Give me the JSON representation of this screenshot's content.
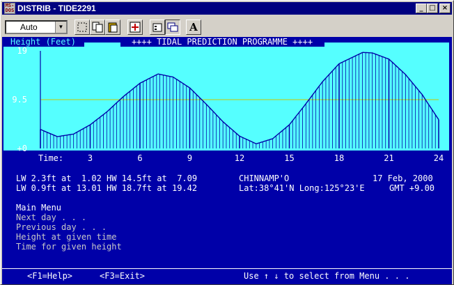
{
  "window": {
    "title": "DISTRIB - TIDE2291",
    "app_icon_text": "MS-DOS"
  },
  "title_buttons": {
    "minimize": "_",
    "maximize": "□",
    "close": "×"
  },
  "toolbar": {
    "font_select": "Auto",
    "font_button_label": "A"
  },
  "chart_data": {
    "type": "area",
    "title": "++++ TIDAL PREDICTION PROGRAMME ++++",
    "ylabel": "Height (Feet)",
    "xlabel": "Time:",
    "xlim": [
      0,
      24
    ],
    "ylim": [
      0,
      19
    ],
    "x_ticks": [
      3,
      6,
      9,
      12,
      15,
      18,
      21,
      24
    ],
    "y_ticks": [
      {
        "value": 19,
        "label": "19"
      },
      {
        "value": 9.5,
        "label": "9.5"
      },
      {
        "value": 0,
        "label": "+0"
      }
    ],
    "series": [
      {
        "x": [
          0,
          1.02,
          2,
          3,
          4,
          5,
          6,
          7.09,
          8,
          9,
          10,
          11,
          12,
          13.01,
          14,
          15,
          16,
          17,
          18,
          19.42,
          20,
          21,
          22,
          23,
          24
        ],
        "y": [
          3.7,
          2.3,
          2.8,
          4.6,
          7.1,
          10.1,
          12.7,
          14.5,
          13.9,
          11.8,
          8.6,
          5.2,
          2.4,
          0.9,
          1.9,
          4.6,
          8.7,
          13.0,
          16.5,
          18.7,
          18.6,
          17.4,
          14.4,
          10.5,
          5.6
        ]
      }
    ],
    "colors": {
      "background": "#55ffff",
      "curve": "#0000a8",
      "gridline": "#c8c800"
    },
    "grid": true
  },
  "tides": {
    "line1": "LW 2.3ft at  1.02 HW 14.5ft at  7.09",
    "line2": "LW 0.9ft at 13.01 HW 18.7ft at 19.42"
  },
  "station": {
    "name": "CHINNAMP'O",
    "date": "17 Feb, 2000",
    "coords": "Lat:38°41'N Long:125°23'E",
    "gmt": "GMT +9.00"
  },
  "menu": {
    "title": "Main Menu",
    "items": [
      "Next day . . .",
      "Previous day . . .",
      "Height at given time",
      "Time for given height"
    ]
  },
  "status": {
    "help": "<F1=Help>",
    "exit": "<F3=Exit>",
    "hint": "Use ↑ ↓ to select from Menu . . ."
  }
}
